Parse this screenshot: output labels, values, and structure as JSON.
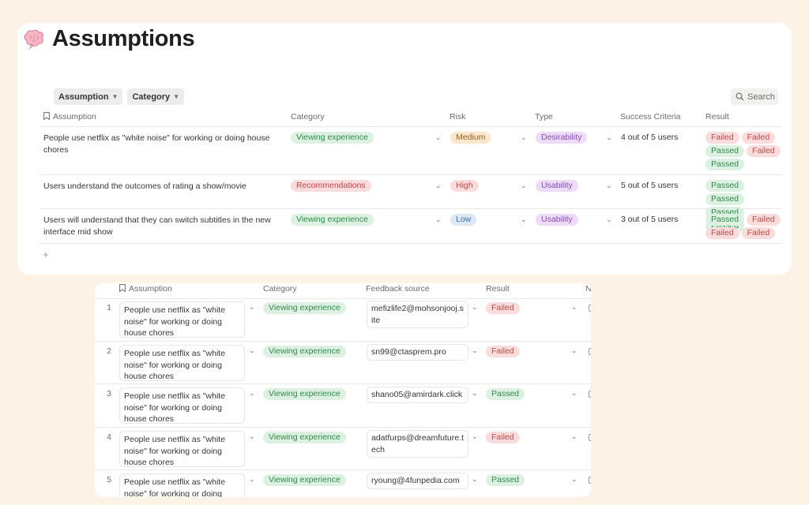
{
  "page": {
    "title": "Assumptions"
  },
  "icons": {
    "page_icon": "brain-icon",
    "search": "search-icon",
    "header_assumption": "bookmark-icon",
    "add": "plus-icon"
  },
  "filters": [
    {
      "label": "Assumption"
    },
    {
      "label": "Category"
    }
  ],
  "search": {
    "label": "Search"
  },
  "main_table": {
    "headers": {
      "assumption": "Assumption",
      "category": "Category",
      "risk": "Risk",
      "type": "Type",
      "success": "Success Criteria",
      "result": "Result"
    },
    "rows": [
      {
        "assumption": "People use netflix as \"white noise\" for working or doing house chores",
        "category": "Viewing experience",
        "risk": "Medium",
        "type": "Desirability",
        "success": "4 out of 5 users",
        "results": [
          "Failed",
          "Failed",
          "Passed",
          "Failed",
          "Passed"
        ]
      },
      {
        "assumption": "Users understand the outcomes of rating a show/movie",
        "category": "Recommendations",
        "risk": "High",
        "type": "Usability",
        "success": "5 out of 5 users",
        "results": [
          "Passed",
          "Passed",
          "Passed",
          "Passed"
        ]
      },
      {
        "assumption": "Users will understand that they can switch subtitles in the new interface mid show",
        "category": "Viewing experience",
        "risk": "Low",
        "type": "Usability",
        "success": "3 out of 5 users",
        "results": [
          "Passed",
          "Failed",
          "Failed",
          "Failed"
        ]
      }
    ],
    "add_label": "+"
  },
  "feedback_table": {
    "headers": {
      "assumption": "Assumption",
      "category": "Category",
      "source": "Feedback source",
      "result": "Result",
      "extra": "N"
    },
    "rows": [
      {
        "num": "1",
        "assumption": "People use netflix as \"white noise\" for working or doing house chores",
        "category": "Viewing experience",
        "source": "mefizlife2@mohsonjooj.site",
        "result": "Failed"
      },
      {
        "num": "2",
        "assumption": "People use netflix as \"white noise\" for working or doing house chores",
        "category": "Viewing experience",
        "source": "sn99@ctasprem.pro",
        "result": "Failed"
      },
      {
        "num": "3",
        "assumption": "People use netflix as \"white noise\" for working or doing house chores",
        "category": "Viewing experience",
        "source": "shano05@amirdark.click",
        "result": "Passed"
      },
      {
        "num": "4",
        "assumption": "People use netflix as \"white noise\" for working or doing house chores",
        "category": "Viewing experience",
        "source": "adatfurps@dreamfuture.tech",
        "result": "Failed"
      },
      {
        "num": "5",
        "assumption": "People use netflix as \"white noise\" for working or doing house chores",
        "category": "Viewing experience",
        "source": "ryoung@4funpedia.com",
        "result": "Passed"
      }
    ]
  },
  "colors": {
    "background": "#fcf3e6",
    "green_tag": "#ddf1e2",
    "red_tag": "#fbdcdc",
    "orange_tag": "#fbe7cd",
    "blue_tag": "#dce8f7",
    "purple_tag": "#ecdcf7"
  }
}
